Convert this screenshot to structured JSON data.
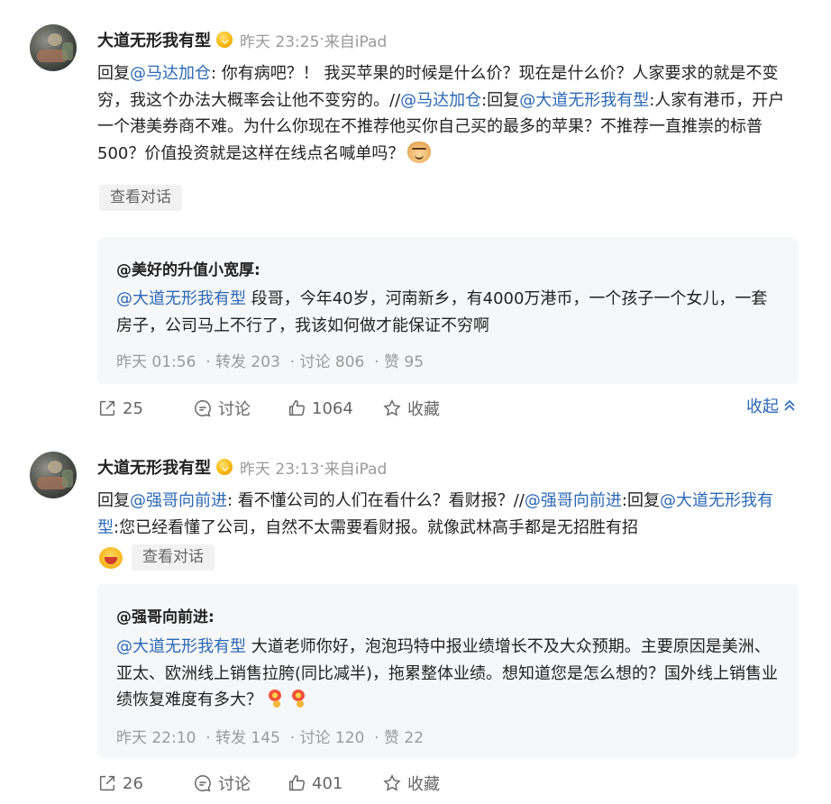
{
  "posts": [
    {
      "username": "大道无形我有型",
      "time": "昨天 23:25",
      "source": "来自iPad",
      "reply_prefix": "回复",
      "reply_to": "@马达加仓",
      "body_1": ": 你有病吧？！ 我买苹果的时候是什么价？现在是什么价？人家要求的就是不变穷，我这个办法大概率会让他不变穷的。//",
      "mention_2": "@马达加仓",
      "body_2": ":回复",
      "mention_3": "@大道无形我有型",
      "body_3": ":人家有港币，开户一个港美券商不难。为什么你现在不推荐他买你自己买的最多的苹果？不推荐一直推崇的标普500？价值投资就是这样在线点名喊单吗？",
      "emoji": "doge",
      "view_conversation": "查看对话",
      "quote": {
        "author": "@美好的升值小宽厚:",
        "mention": "@大道无形我有型",
        "text": " 段哥，今年40岁，河南新乡，有4000万港币，一个孩子一个女儿，一套房子，公司马上不行了，我该如何做才能保证不穷啊",
        "time": "昨天 01:56",
        "repost": "转发 203",
        "comment": "讨论 806",
        "like": "赞 95"
      },
      "actions": {
        "share": "25",
        "comment": "讨论",
        "like": "1064",
        "favorite": "收藏"
      },
      "collapse": "收起"
    },
    {
      "username": "大道无形我有型",
      "time": "昨天 23:13",
      "source": "来自iPad",
      "reply_prefix": "回复",
      "reply_to": "@强哥向前进",
      "body_1": ": 看不懂公司的人们在看什么？看财报？//",
      "mention_2": "@强哥向前进",
      "body_2": ":回复",
      "mention_3": "@大道无形我有型",
      "body_3": ":您已经看懂了公司，自然不太需要看财报。就像武林高手都是无招胜有招",
      "emoji": "laugh",
      "view_conversation": "查看对话",
      "quote": {
        "author": "@强哥向前进:",
        "mention": "@大道无形我有型",
        "text": " 大道老师你好，泡泡玛特中报业绩增长不及大众预期。主要原因是美洲、亚太、欧洲线上销售拉胯(同比减半)，拖累整体业绩。想知道您是怎么想的？国外线上销售业绩恢复难度有多大？",
        "time": "昨天 22:10",
        "repost": "转发 145",
        "comment": "讨论 120",
        "like": "赞 22"
      },
      "actions": {
        "share": "26",
        "comment": "讨论",
        "like": "401",
        "favorite": "收藏"
      }
    }
  ],
  "colors": {
    "link": "#2b68b4",
    "meta": "#9a9a9a",
    "quote_bg": "#f6f7f8"
  }
}
